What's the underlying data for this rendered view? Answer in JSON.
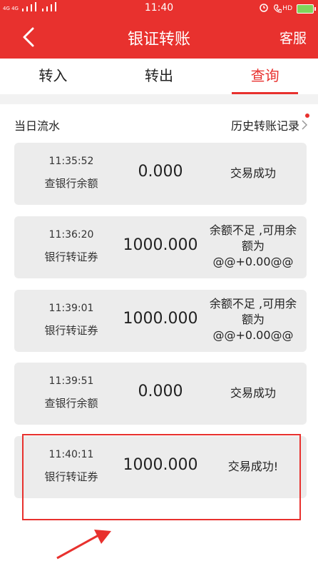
{
  "status_bar": {
    "network": "4G 4G",
    "time": "11:40",
    "hd": "HD"
  },
  "header": {
    "title": "银证转账",
    "service": "客服"
  },
  "tabs": [
    {
      "label": "转入"
    },
    {
      "label": "转出"
    },
    {
      "label": "查询"
    }
  ],
  "section": {
    "title": "当日流水",
    "history": "历史转账记录"
  },
  "records": [
    {
      "time": "11:35:52",
      "type": "查银行余额",
      "amount": "0.000",
      "status": "交易成功"
    },
    {
      "time": "11:36:20",
      "type": "银行转证券",
      "amount": "1000.000",
      "status": "余额不足 ,可用余额为@@+0.00@@"
    },
    {
      "time": "11:39:01",
      "type": "银行转证券",
      "amount": "1000.000",
      "status": "余额不足 ,可用余额为@@+0.00@@"
    },
    {
      "time": "11:39:51",
      "type": "查银行余额",
      "amount": "0.000",
      "status": "交易成功"
    },
    {
      "time": "11:40:11",
      "type": "银行转证券",
      "amount": "1000.000",
      "status": "交易成功!"
    }
  ],
  "colors": {
    "brand_red": "#e8312e",
    "card_bg": "#ececec",
    "annotation": "#e8312e"
  }
}
